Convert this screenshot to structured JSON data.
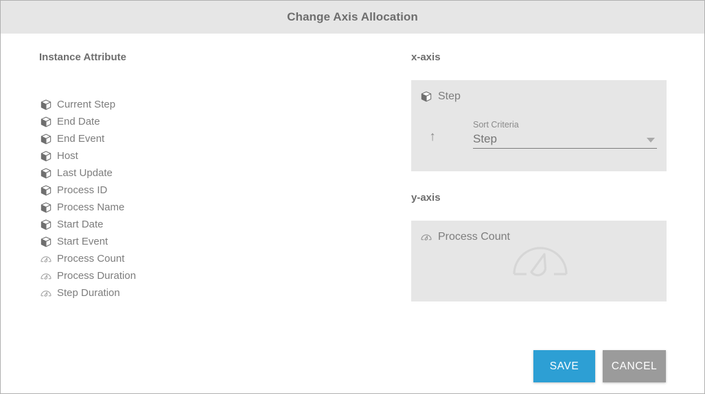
{
  "dialog": {
    "title": "Change Axis Allocation"
  },
  "attributes": {
    "heading": "Instance Attribute",
    "items": [
      {
        "label": "Current Step",
        "icon": "cube-icon"
      },
      {
        "label": "End Date",
        "icon": "cube-icon"
      },
      {
        "label": "End Event",
        "icon": "cube-icon"
      },
      {
        "label": "Host",
        "icon": "cube-icon"
      },
      {
        "label": "Last Update",
        "icon": "cube-icon"
      },
      {
        "label": "Process ID",
        "icon": "cube-icon"
      },
      {
        "label": "Process Name",
        "icon": "cube-icon"
      },
      {
        "label": "Start Date",
        "icon": "cube-icon"
      },
      {
        "label": "Start Event",
        "icon": "cube-icon"
      },
      {
        "label": "Process Count",
        "icon": "gauge-icon"
      },
      {
        "label": "Process Duration",
        "icon": "gauge-icon"
      },
      {
        "label": "Step Duration",
        "icon": "gauge-icon"
      }
    ]
  },
  "x_axis": {
    "heading": "x-axis",
    "chip_label": "Step",
    "chip_icon": "cube-icon",
    "sort_direction_icon": "arrow-up-icon",
    "sort_criteria_label": "Sort Criteria",
    "sort_criteria_value": "Step",
    "dropdown_icon": "chevron-down-icon"
  },
  "y_axis": {
    "heading": "y-axis",
    "chip_label": "Process Count",
    "chip_icon": "gauge-icon",
    "watermark_icon": "gauge-icon"
  },
  "footer": {
    "save_label": "SAVE",
    "cancel_label": "CANCEL"
  },
  "colors": {
    "header_background": "#e6e6e6",
    "panel_background": "#e6e6e6",
    "save_button": "#2d9fd4",
    "cancel_button": "#9b9b9b",
    "title_text": "#6e6e6e",
    "body_text": "#7d7d7d"
  }
}
